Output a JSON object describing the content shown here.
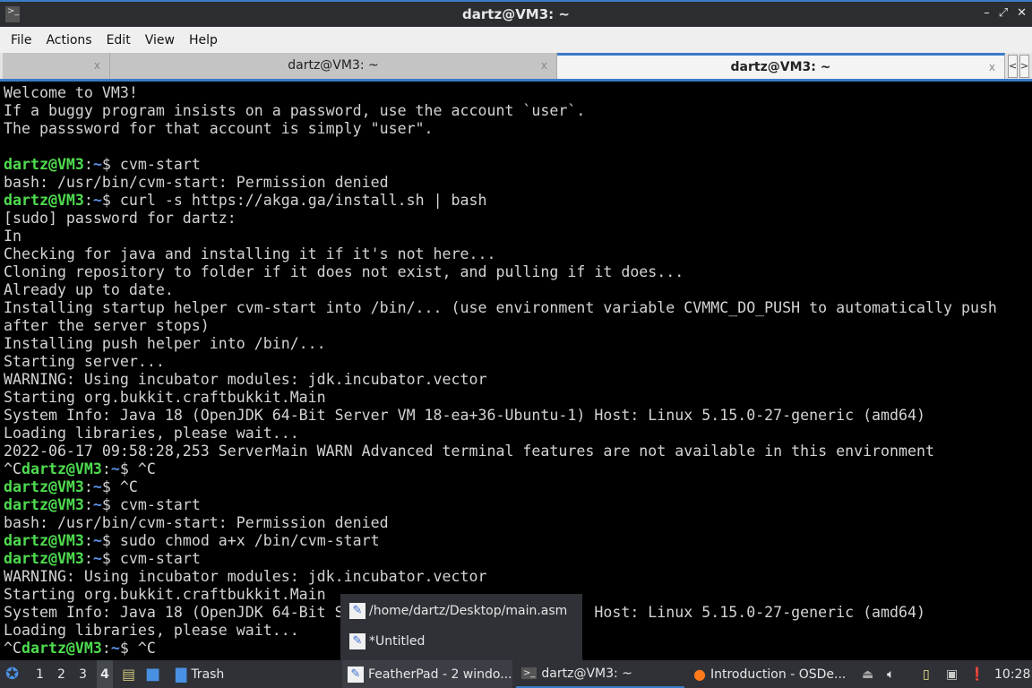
{
  "window": {
    "title": "dartz@VM3: ~",
    "controls": [
      "–",
      "⤢",
      "✕"
    ]
  },
  "menu": [
    "File",
    "Actions",
    "Edit",
    "View",
    "Help"
  ],
  "tabs": [
    {
      "label": ""
    },
    {
      "label": "dartz@VM3: ~"
    },
    {
      "label": "dartz@VM3: ~",
      "active": true
    }
  ],
  "tab_close": "x",
  "tab_nav": [
    "<",
    ">"
  ],
  "prompt": {
    "user": "dartz@VM3",
    "colon": ":",
    "path": "~",
    "dollar": "$ "
  },
  "terminal_lines": [
    {
      "text": "Welcome to VM3!"
    },
    {
      "text": "If a buggy program insists on a password, use the account `user`."
    },
    {
      "text": "The passsword for that account is simply \"user\"."
    },
    {
      "text": ""
    },
    {
      "prompt": true,
      "cmd": "cvm-start"
    },
    {
      "text": "bash: /usr/bin/cvm-start: Permission denied"
    },
    {
      "prompt": true,
      "cmd": "curl -s https://akga.ga/install.sh | bash"
    },
    {
      "text": "[sudo] password for dartz:"
    },
    {
      "text": "In"
    },
    {
      "text": "Checking for java and installing it if it's not here..."
    },
    {
      "text": "Cloning repository to folder if it does not exist, and pulling if it does..."
    },
    {
      "text": "Already up to date."
    },
    {
      "text": "Installing startup helper cvm-start into /bin/... (use environment variable CVMMC_DO_PUSH to automatically push"
    },
    {
      "text": "after the server stops)"
    },
    {
      "text": "Installing push helper into /bin/..."
    },
    {
      "text": "Starting server..."
    },
    {
      "text": "WARNING: Using incubator modules: jdk.incubator.vector"
    },
    {
      "text": "Starting org.bukkit.craftbukkit.Main"
    },
    {
      "text": "System Info: Java 18 (OpenJDK 64-Bit Server VM 18-ea+36-Ubuntu-1) Host: Linux 5.15.0-27-generic (amd64)"
    },
    {
      "text": "Loading libraries, please wait..."
    },
    {
      "text": "2022-06-17 09:58:28,253 ServerMain WARN Advanced terminal features are not available in this environment"
    },
    {
      "pre": "^C",
      "prompt": true,
      "cmd": "^C"
    },
    {
      "prompt": true,
      "cmd": "^C"
    },
    {
      "prompt": true,
      "cmd": "cvm-start"
    },
    {
      "text": "bash: /usr/bin/cvm-start: Permission denied"
    },
    {
      "prompt": true,
      "cmd": "sudo chmod a+x /bin/cvm-start"
    },
    {
      "prompt": true,
      "cmd": "cvm-start"
    },
    {
      "text": "WARNING: Using incubator modules: jdk.incubator.vector"
    },
    {
      "text": "Starting org.bukkit.craftbukkit.Main"
    },
    {
      "text": "System Info: Java 18 (OpenJDK 64-Bit Server VM 18-ea+36-Ubuntu-1) Host: Linux 5.15.0-27-generic (amd64)"
    },
    {
      "text": "Loading libraries, please wait..."
    },
    {
      "pre": "^C",
      "prompt": true,
      "cmd": "^C"
    }
  ],
  "popup": [
    "/home/dartz/Desktop/main.asm",
    "*Untitled"
  ],
  "taskbar": {
    "desktops": [
      "1",
      "2",
      "3",
      "4"
    ],
    "trash": "Trash",
    "tasks": [
      "FeatherPad - 2 windo...",
      "dartz@VM3: ~",
      "Introduction - OSDe..."
    ],
    "clock": "10:28"
  },
  "colors": {
    "accent": "#3a7bc8",
    "prompt_user": "#4fdc4f",
    "prompt_path": "#5c8fe6"
  }
}
